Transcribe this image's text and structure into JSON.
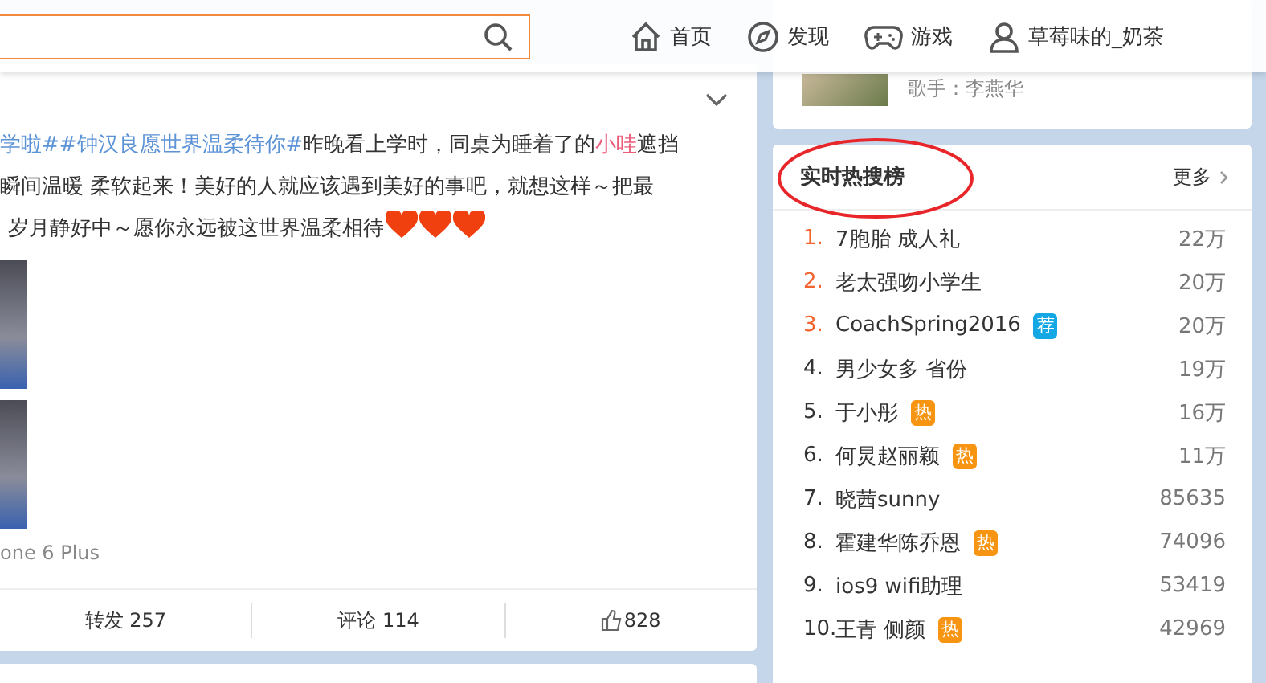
{
  "nav": {
    "items": [
      {
        "kind": "home",
        "label": "首页"
      },
      {
        "kind": "discover",
        "label": "发现"
      },
      {
        "kind": "games",
        "label": "游戏"
      },
      {
        "kind": "user",
        "label": "草莓味的_奶茶"
      }
    ]
  },
  "post": {
    "lines": [
      [
        {
          "kind": "topic",
          "text": "学啦##钟汉良愿世界温柔待你#"
        },
        {
          "kind": "plain",
          "text": "昨晚看上学时，同桌为睡着了的"
        },
        {
          "kind": "mention",
          "text": "小哇"
        },
        {
          "kind": "plain",
          "text": "遮挡"
        }
      ],
      [
        {
          "kind": "plain",
          "text": "瞬间温暖 柔软起来！美好的人就应该遇到美好的事吧，就想这样～把最"
        }
      ],
      [
        {
          "kind": "plain",
          "text": "岁月静好中～愿你永远被这世界温柔相待"
        }
      ]
    ],
    "source": "one 6 Plus",
    "actions": [
      {
        "kind": "repost",
        "label": "转发 257"
      },
      {
        "kind": "comment",
        "label": "评论 114"
      },
      {
        "kind": "like",
        "label": "828"
      }
    ]
  },
  "music": {
    "artist": "歌手：李燕华"
  },
  "hot": {
    "title": "实时热搜榜",
    "more": "更多",
    "items": [
      {
        "rank": "1.",
        "top": true,
        "name": "7胞胎 成人礼",
        "count": "22万"
      },
      {
        "rank": "2.",
        "top": true,
        "name": "老太强吻小学生",
        "count": "20万"
      },
      {
        "rank": "3.",
        "top": true,
        "name": "CoachSpring2016",
        "badge": {
          "kind": "recommend",
          "text": "荐"
        },
        "count": "20万"
      },
      {
        "rank": "4.",
        "top": false,
        "name": "男少女多 省份",
        "count": "19万"
      },
      {
        "rank": "5.",
        "top": false,
        "name": "于小彤",
        "badge": {
          "kind": "hot",
          "text": "热"
        },
        "count": "16万"
      },
      {
        "rank": "6.",
        "top": false,
        "name": "何炅赵丽颖",
        "badge": {
          "kind": "hot",
          "text": "热"
        },
        "count": "11万"
      },
      {
        "rank": "7.",
        "top": false,
        "name": "晓茜sunny",
        "count": "85635"
      },
      {
        "rank": "8.",
        "top": false,
        "name": "霍建华陈乔恩",
        "badge": {
          "kind": "hot",
          "text": "热"
        },
        "count": "74096"
      },
      {
        "rank": "9.",
        "top": false,
        "name": "ios9 wifi助理",
        "count": "53419"
      },
      {
        "rank": "10.",
        "top": false,
        "name": "王青 侧颜",
        "badge": {
          "kind": "hot",
          "text": "热"
        },
        "count": "42969"
      }
    ]
  }
}
